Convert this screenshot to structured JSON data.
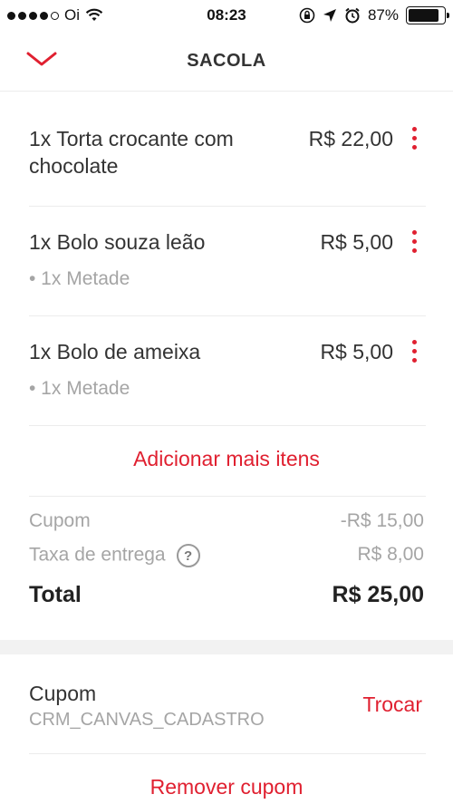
{
  "status_bar": {
    "carrier": "Oi",
    "time": "08:23",
    "battery": "87%",
    "battery_level": 0.87
  },
  "header": {
    "title": "SACOLA"
  },
  "items": [
    {
      "name": "1x Torta crocante com chocolate",
      "price": "R$ 22,00"
    },
    {
      "name": "1x Bolo souza leão",
      "price": "R$ 5,00",
      "option": "• 1x Metade"
    },
    {
      "name": "1x Bolo de ameixa",
      "price": "R$ 5,00",
      "option": "• 1x Metade"
    }
  ],
  "add_more_label": "Adicionar mais itens",
  "summary": {
    "coupon_label": "Cupom",
    "coupon_value": "-R$ 15,00",
    "delivery_label": "Taxa de entrega",
    "delivery_help": "?",
    "delivery_value": "R$ 8,00",
    "total_label": "Total",
    "total_value": "R$ 25,00"
  },
  "coupon": {
    "label": "Cupom",
    "code": "CRM_CANVAS_CADASTRO",
    "change_label": "Trocar",
    "remove_label": "Remover cupom"
  },
  "colors": {
    "accent": "#e02030",
    "muted_text": "#a5a5a5"
  }
}
